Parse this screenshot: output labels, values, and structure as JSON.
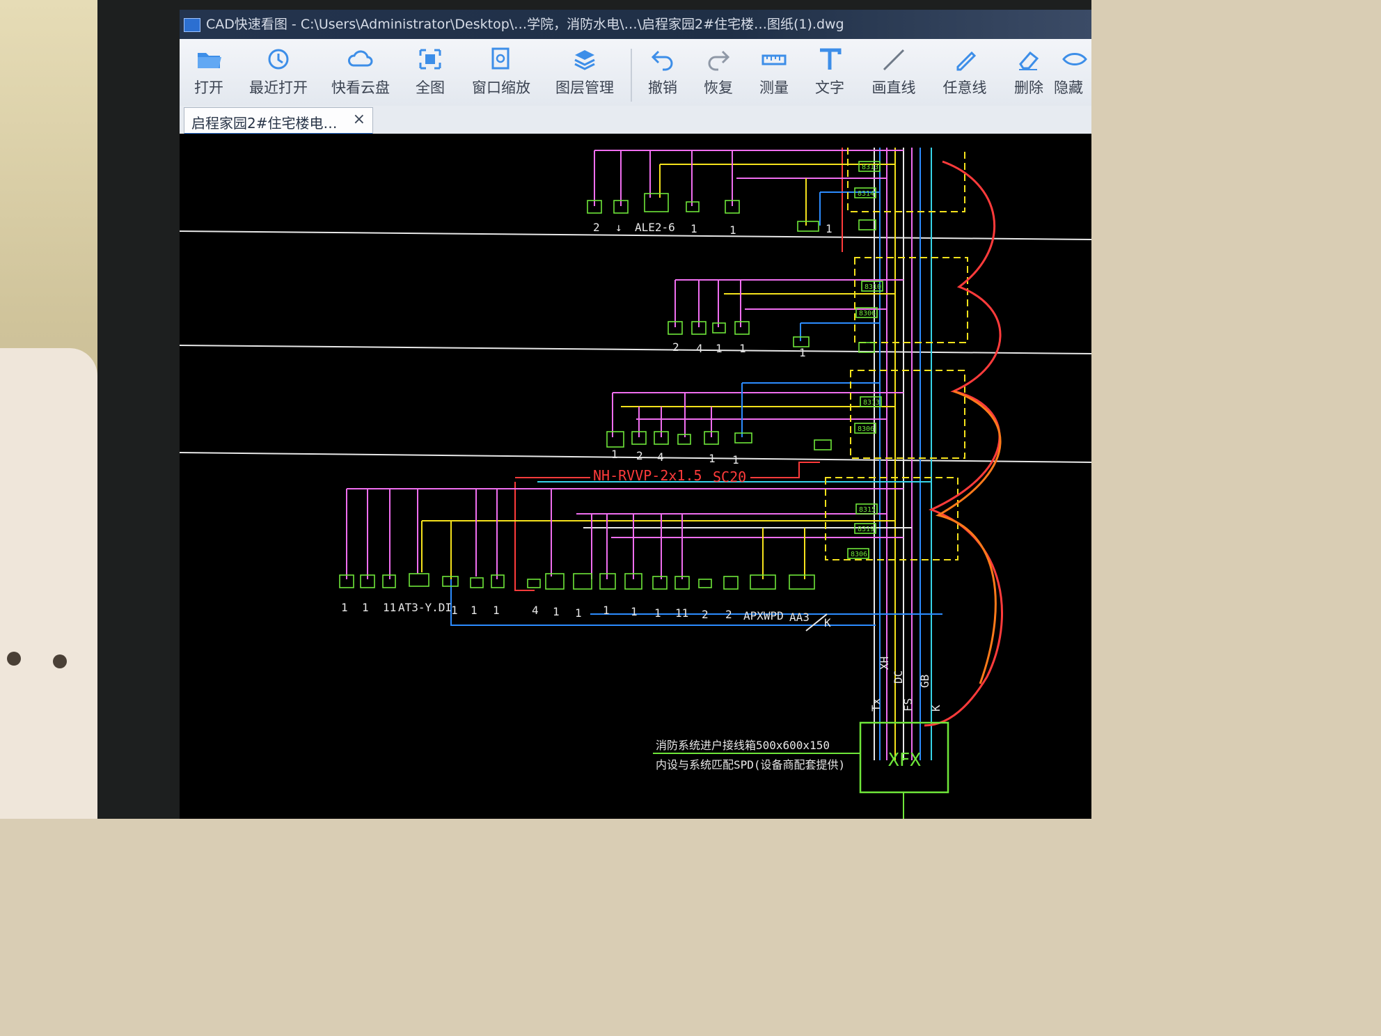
{
  "window": {
    "title": "CAD快速看图 - C:\\Users\\Administrator\\Desktop\\…学院，消防水电\\…\\启程家园2#住宅楼…图纸(1).dwg"
  },
  "toolbar": {
    "buttons": [
      {
        "label": "打开",
        "icon": "folder-open-icon"
      },
      {
        "label": "最近打开",
        "icon": "clock-history-icon"
      },
      {
        "label": "快看云盘",
        "icon": "cloud-icon"
      },
      {
        "label": "全图",
        "icon": "fit-all-icon"
      },
      {
        "label": "窗口缩放",
        "icon": "window-zoom-icon"
      },
      {
        "label": "图层管理",
        "icon": "layers-icon"
      },
      {
        "label": "撤销",
        "icon": "undo-icon"
      },
      {
        "label": "恢复",
        "icon": "redo-icon"
      },
      {
        "label": "测量",
        "icon": "ruler-icon"
      },
      {
        "label": "文字",
        "icon": "text-icon"
      },
      {
        "label": "画直线",
        "icon": "line-icon"
      },
      {
        "label": "任意线",
        "icon": "pen-icon"
      },
      {
        "label": "删除",
        "icon": "eraser-icon"
      },
      {
        "label": "隐藏",
        "icon": "hide-icon"
      }
    ]
  },
  "tabs": [
    {
      "label": "启程家园2#住宅楼电…",
      "close": "×"
    }
  ],
  "drawing": {
    "row1_labels": [
      "2",
      "↓",
      "ALE2-6",
      "1",
      "1",
      "1"
    ],
    "row2_labels": [
      "2",
      "4",
      "1",
      "1",
      "1"
    ],
    "row3_labels": [
      "1",
      "2",
      "4",
      "1",
      "1"
    ],
    "cable_label": "NH-RVVP-2x1.5",
    "conduit_label": "SC20",
    "row4_labels": [
      "1",
      "1",
      "11",
      "AT3-Y.DI",
      "1",
      "1",
      "1",
      "4",
      "1",
      "1",
      "1",
      "1",
      "1",
      "11",
      "2",
      "2",
      "APXWPD",
      "AA3",
      "K"
    ],
    "trunk_labels": [
      "Tx",
      "XH",
      "DC",
      "FS",
      "GB",
      "K"
    ],
    "junction_box_label": "XFX",
    "note_line1": "消防系统进户接线箱500x600x150",
    "note_line2": "内设与系统匹配SPD(设备商配套提供)",
    "device_tags": [
      "8313",
      "8314",
      "8310",
      "8306",
      "8313",
      "8306",
      "8315",
      "8319",
      "8306"
    ],
    "colors": {
      "magenta": "#f06ef0",
      "yellow": "#f5e21c",
      "white": "#e8e8e8",
      "blue": "#2c8cff",
      "cyan": "#37d4e8",
      "green": "#6fe63a",
      "red": "#ff3b3b",
      "orange": "#ff7a1a"
    }
  }
}
